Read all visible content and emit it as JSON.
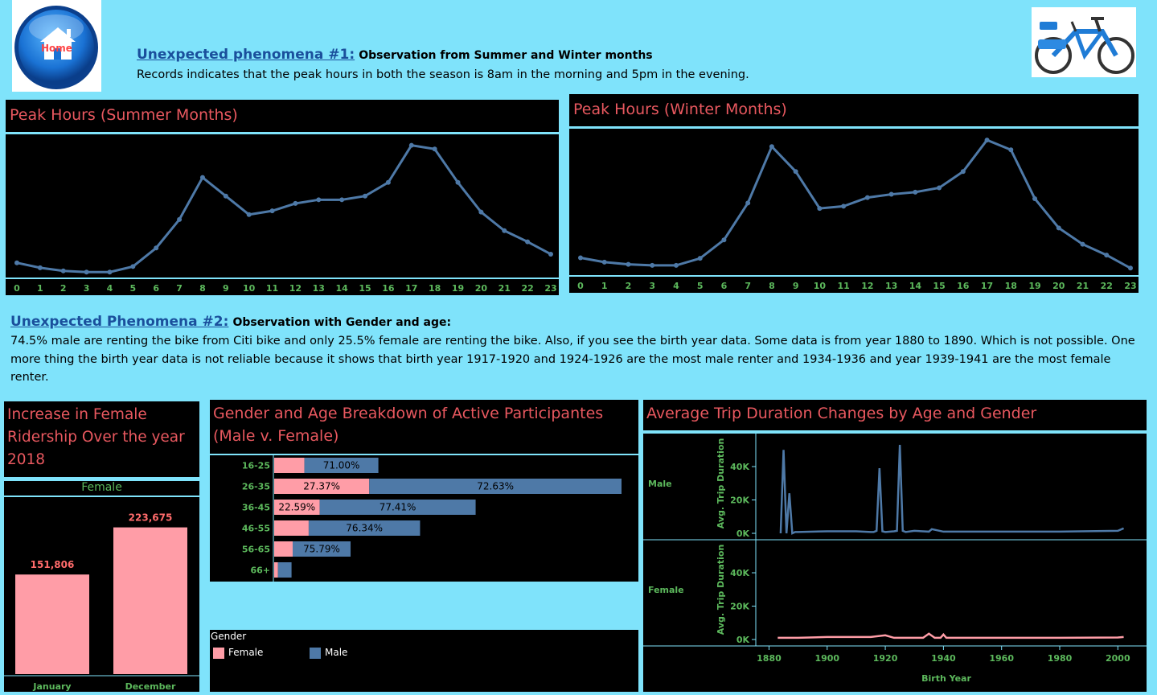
{
  "header": {
    "home_label": "Home",
    "title1_link": "Unexpected phenomena #1:",
    "title1_sub": "Observation from Summer and Winter months",
    "title1_body": "Records indicates that the peak hours in both the season is 8am in the morning and 5pm in the evening.",
    "title2_link": "Unexpected Phenomena #2:",
    "title2_sub": "Observation with Gender and age:",
    "title2_body": "74.5% male are renting the bike from Citi bike and only 25.5% female are renting the bike. Also, if you see the birth year data. Some data is from year 1880 to 1890. Which is not possible. One more thing the birth year data is not reliable because it shows that birth year 1917-1920 and 1924-1926 are the most male renter and 1934-1936 and year 1939-1941 are the most female renter."
  },
  "colors": {
    "background": "#7fe3fb",
    "title_red": "#e8585f",
    "tick_green": "#5cb85c",
    "male_blue": "#4e79a7",
    "female_pink": "#ff9da7",
    "link_blue": "#1a4f9c"
  },
  "icons": {
    "home": "home-icon",
    "bike": "bike-image"
  },
  "summer": {
    "title": "Peak Hours (Summer Months)",
    "chart_data": {
      "type": "line",
      "x": [
        0,
        1,
        2,
        3,
        4,
        5,
        6,
        7,
        8,
        9,
        10,
        11,
        12,
        13,
        14,
        15,
        16,
        17,
        18,
        19,
        20,
        21,
        22,
        23
      ],
      "values": [
        8,
        4,
        1.5,
        0.5,
        0.5,
        5,
        20,
        43,
        77,
        62,
        47,
        50,
        56,
        59,
        59,
        62,
        73,
        103,
        100,
        73,
        49,
        34,
        25,
        15
      ],
      "ylim": [
        0,
        108
      ],
      "grid": false
    }
  },
  "winter": {
    "title": "Peak Hours (Winter Months)",
    "chart_data": {
      "type": "line",
      "x": [
        0,
        1,
        2,
        3,
        4,
        5,
        6,
        7,
        8,
        9,
        10,
        11,
        12,
        13,
        14,
        15,
        16,
        17,
        18,
        19,
        20,
        21,
        22,
        23
      ],
      "values": [
        7.5,
        3.5,
        1.5,
        0.5,
        0.5,
        7,
        24,
        58,
        110,
        87,
        53,
        55,
        63,
        66,
        68,
        72,
        87,
        116,
        107,
        62,
        35,
        20,
        10,
        -2
      ],
      "ylim": [
        -4,
        122
      ],
      "grid": false
    }
  },
  "female_increase": {
    "title": "Increase in Female Ridership Over the year 2018",
    "header": "Female",
    "chart_data": {
      "type": "bar",
      "categories": [
        "January",
        "December"
      ],
      "values": [
        151806,
        223675
      ],
      "value_labels": [
        "151,806",
        "223,675"
      ],
      "ylim": [
        0,
        260000
      ]
    }
  },
  "gender_age": {
    "title": "Gender and Age Breakdown of Active Participantes (Male v. Female)",
    "chart_data": {
      "type": "bar",
      "orientation": "horizontal",
      "stacked": true,
      "categories": [
        "16-25",
        "26-35",
        "36-45",
        "46-55",
        "56-65",
        "66+"
      ],
      "series": [
        {
          "name": "Female",
          "values": [
            29.0,
            27.37,
            22.59,
            23.66,
            24.21,
            22.0
          ],
          "labels": [
            "",
            "27.37%",
            "22.59%",
            "",
            "",
            ""
          ]
        },
        {
          "name": "Male",
          "values": [
            71.0,
            72.63,
            77.41,
            76.34,
            75.79,
            78.0
          ],
          "labels": [
            "71.00%",
            "72.63%",
            "77.41%",
            "76.34%",
            "75.79%",
            ""
          ]
        }
      ],
      "totals_relative": [
        0.3,
        1.0,
        0.58,
        0.42,
        0.22,
        0.05
      ]
    },
    "legend": {
      "title": "Gender",
      "items": [
        "Female",
        "Male"
      ]
    }
  },
  "trip_duration": {
    "title": "Average Trip Duration Changes by Age and Gender",
    "chart_data": {
      "type": "line",
      "xlabel": "Birth Year",
      "ylabel": "Avg. Trip Duration",
      "x_ticks": [
        1880,
        1900,
        1920,
        1940,
        1960,
        1980,
        2000
      ],
      "y_ticks_labels": [
        "0K",
        "20K",
        "40K"
      ],
      "xlim": [
        1876,
        2006
      ],
      "ylim": [
        0,
        54000
      ],
      "panels": [
        {
          "name": "Male",
          "x": [
            1884,
            1885,
            1886,
            1887,
            1888,
            1889,
            1890,
            1900,
            1910,
            1915,
            1916,
            1917,
            1918,
            1919,
            1920,
            1923,
            1924,
            1925,
            1926,
            1927,
            1930,
            1935,
            1936,
            1940,
            1960,
            1980,
            2000,
            2002
          ],
          "values": [
            0,
            50000,
            0,
            24000,
            0,
            800,
            800,
            1200,
            1200,
            800,
            800,
            1500,
            39000,
            1200,
            800,
            1200,
            1500,
            53000,
            1500,
            800,
            1500,
            1000,
            2500,
            1000,
            1000,
            1000,
            1500,
            3000
          ]
        },
        {
          "name": "Female",
          "x": [
            1883,
            1886,
            1890,
            1900,
            1915,
            1920,
            1923,
            1930,
            1933,
            1935,
            1937,
            1939,
            1940,
            1941,
            1950,
            1960,
            1980,
            2000,
            2002
          ],
          "values": [
            1000,
            1000,
            1000,
            1500,
            1500,
            2500,
            1000,
            1000,
            1000,
            3500,
            1000,
            1000,
            3000,
            1000,
            1000,
            1000,
            1000,
            1200,
            1500
          ]
        }
      ]
    }
  }
}
